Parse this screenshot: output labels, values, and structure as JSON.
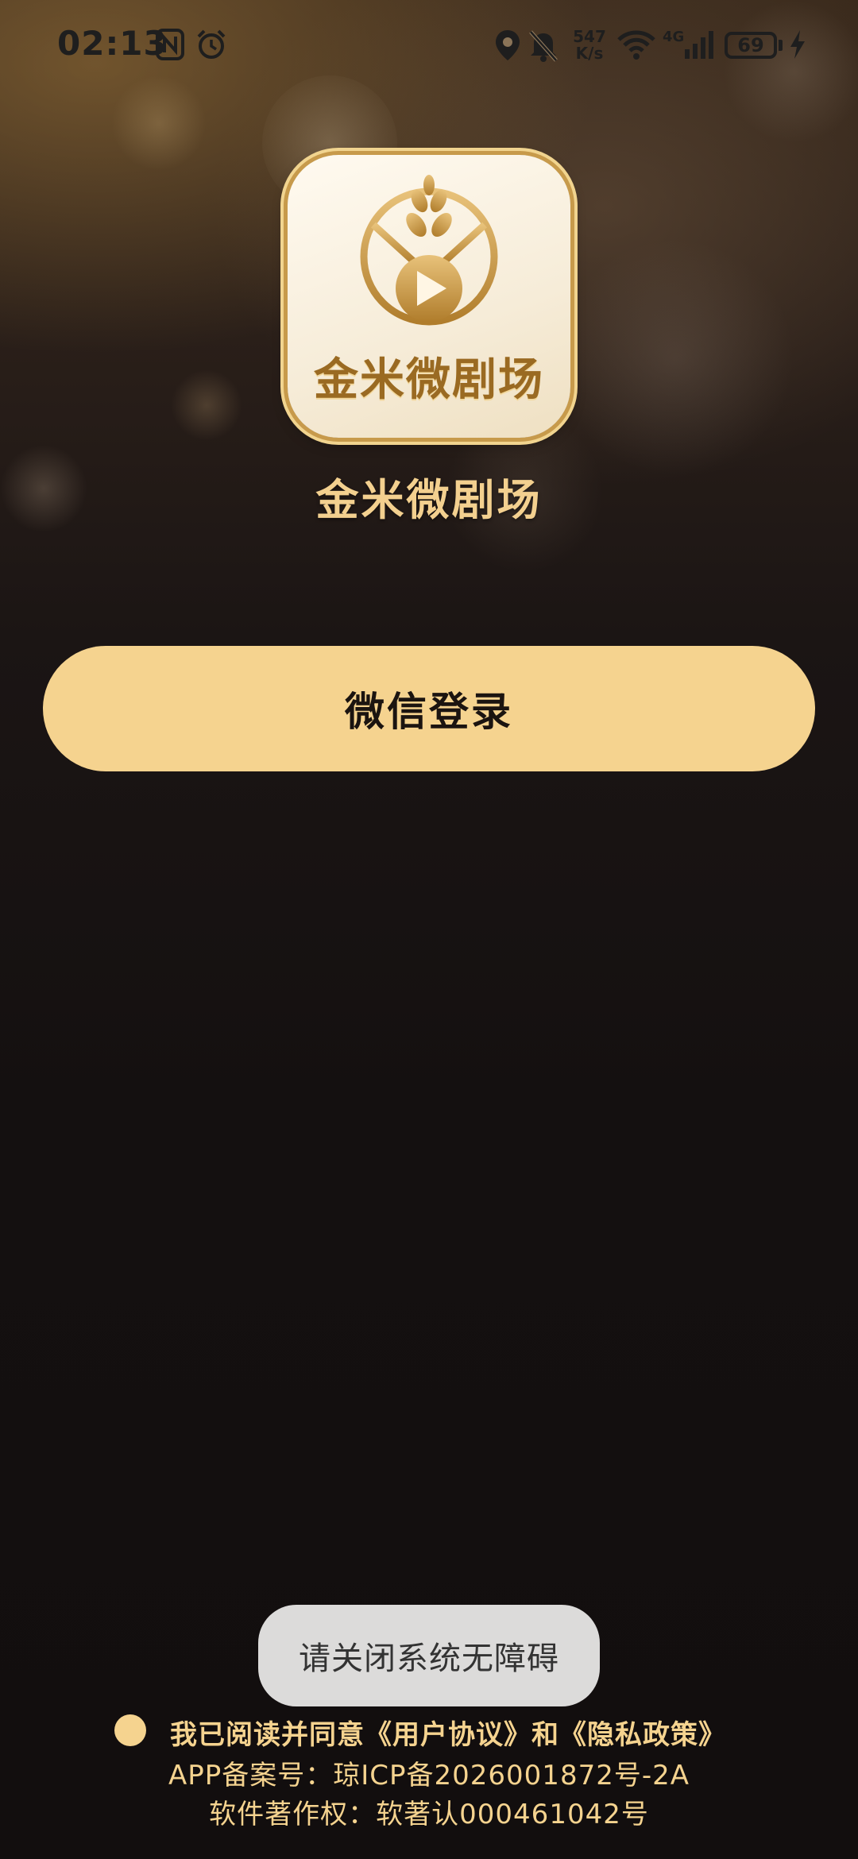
{
  "status_bar": {
    "time": "02:13",
    "net_speed_value": "547",
    "net_speed_unit": "K/s",
    "network_type": "4G",
    "battery": "69",
    "icons": [
      "nfc-icon",
      "alarm-icon",
      "location-icon",
      "mute-bell-icon",
      "wifi-icon",
      "signal-icon",
      "battery-icon",
      "charging-icon"
    ]
  },
  "logo": {
    "text": "金米微剧场",
    "colors": {
      "gold": "#c79a4b",
      "gold_light": "#f1d48f",
      "card_bg": "#fffaf0"
    }
  },
  "app_name": "金米微剧场",
  "login": {
    "wechat_label": "微信登录",
    "button_color": "#f5d38f"
  },
  "toast": {
    "message": "请关闭系统无障碍"
  },
  "footer": {
    "agree_prefix": "我已阅读并同意",
    "user_agreement": "《用户协议》",
    "and": "和",
    "privacy_policy": "《隐私政策》",
    "icp": "APP备案号：琼ICP备2026001872号-2A",
    "copyright": "软件著作权：软著认000461042号",
    "accent_color": "#f5d38f"
  }
}
